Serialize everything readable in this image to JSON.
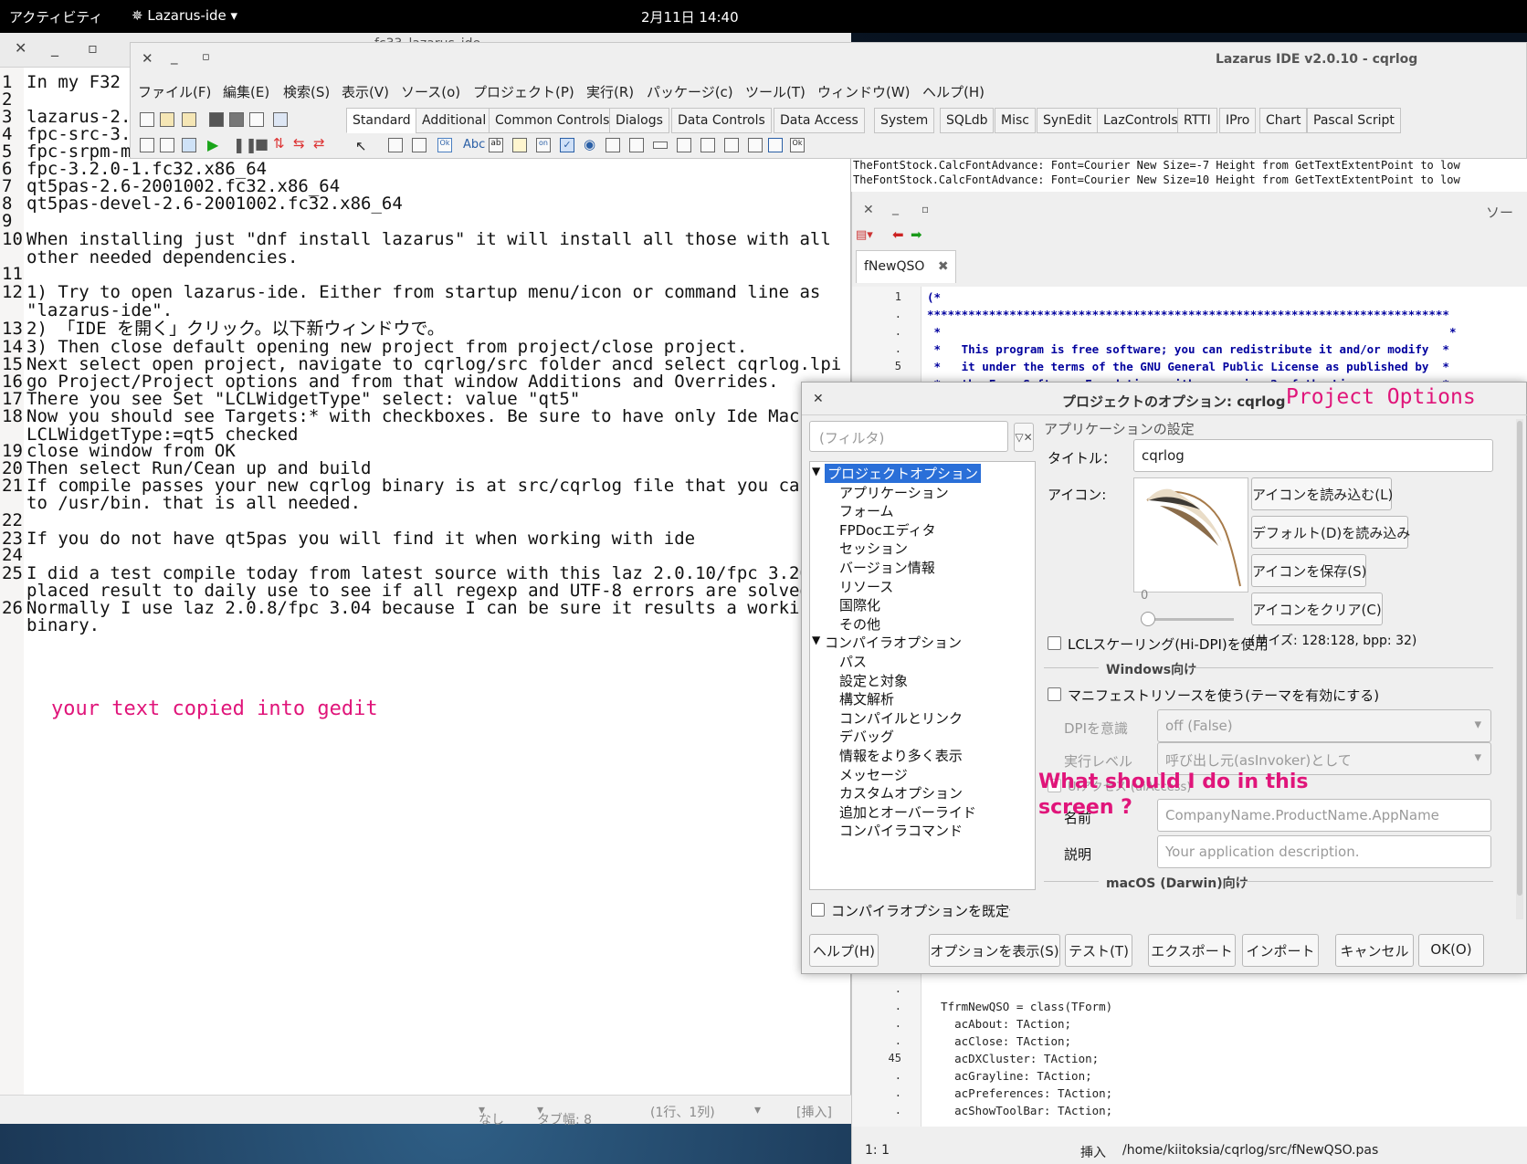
{
  "topbar": {
    "activities": "アクティビティ",
    "app_menu": "Lazarus-ide",
    "clock": "2月11日 14:40"
  },
  "gedit": {
    "lines": [
      {
        "n": "1",
        "t": "In my F32 s"
      },
      {
        "n": "2",
        "t": ""
      },
      {
        "n": "3",
        "t": "lazarus-2.0"
      },
      {
        "n": "4",
        "t": "fpc-src-3.2"
      },
      {
        "n": "5",
        "t": "fpc-srpm-ma"
      },
      {
        "n": "6",
        "t": "fpc-3.2.0-1.fc32.x86_64"
      },
      {
        "n": "7",
        "t": "qt5pas-2.6-2001002.fc32.x86_64"
      },
      {
        "n": "8",
        "t": "qt5pas-devel-2.6-2001002.fc32.x86_64"
      },
      {
        "n": "9",
        "t": ""
      },
      {
        "n": "10",
        "t": "When installing just \"dnf install lazarus\" it will install all those with all"
      },
      {
        "n": "",
        "t": "other needed dependencies."
      },
      {
        "n": "11",
        "t": ""
      },
      {
        "n": "12",
        "t": "1) Try to open lazarus-ide. Either from startup menu/icon or command line as"
      },
      {
        "n": "",
        "t": "\"lazarus-ide\"."
      },
      {
        "n": "13",
        "t": "2) 「IDE を開く」クリック。以下新ウィンドウで。"
      },
      {
        "n": "14",
        "t": "3) Then close default opening new project from project/close project."
      },
      {
        "n": "15",
        "t": "Next select open project, navigate to cqrlog/src folder ancd select cqrlog.lpi"
      },
      {
        "n": "16",
        "t": "go Project/Project options and from that window Additions and Overrides."
      },
      {
        "n": "17",
        "t": "There you see Set \"LCLWidgetType\" select: value \"qt5\""
      },
      {
        "n": "18",
        "t": "Now you should see Targets:* with checkboxes. Be sure to have only Ide Macro"
      },
      {
        "n": "",
        "t": "LCLWidgetType:=qt5 checked"
      },
      {
        "n": "19",
        "t": "close window from OK"
      },
      {
        "n": "20",
        "t": "Then select Run/Cean up and build"
      },
      {
        "n": "21",
        "t": "If compile passes your new cqrlog binary is at src/cqrlog file that you can co"
      },
      {
        "n": "",
        "t": "to /usr/bin. that is all needed."
      },
      {
        "n": "22",
        "t": ""
      },
      {
        "n": "23",
        "t": "If you do not have qt5pas you will find it when working with ide"
      },
      {
        "n": "24",
        "t": ""
      },
      {
        "n": "25",
        "t": "I did a test compile today from latest source with this laz 2.0.10/fpc 3.20 an"
      },
      {
        "n": "",
        "t": "placed result to daily use to see if all regexp and UTF-8 errors are solved no"
      },
      {
        "n": "26",
        "t": "Normally I use laz 2.0.8/fpc 3.04 because I can be sure it results a working"
      },
      {
        "n": "",
        "t": "binary."
      }
    ],
    "annotation": "your text copied into gedit",
    "status": {
      "lang": "なし",
      "tab": "タブ幅: 8",
      "pos": "(1行、1列)",
      "mode": "[挿入]"
    }
  },
  "gedit_tab_title": "fc33_lazarus_ide",
  "lazarus": {
    "title": "Lazarus IDE v2.0.10 - cqrlog",
    "menu": [
      "ファイル(F)",
      "編集(E)",
      "検索(S)",
      "表示(V)",
      "ソース(o)",
      "プロジェクト(P)",
      "実行(R)",
      "パッケージ(c)",
      "ツール(T)",
      "ウィンドウ(W)",
      "ヘルプ(H)"
    ],
    "palette_tabs": [
      "Standard",
      "Additional",
      "Common Controls",
      "Dialogs",
      "Data Controls",
      "Data Access",
      "System",
      "SQLdb",
      "Misc",
      "SynEdit",
      "LazControls",
      "RTTI",
      "IPro",
      "Chart",
      "Pascal Script"
    ]
  },
  "messages": [
    "TheFontStock.CalcFontAdvance: Font=Courier New Size=-7 Height from GetTextExtentPoint to low",
    "TheFontStock.CalcFontAdvance: Font=Courier New Size=10 Height from GetTextExtentPoint to low"
  ],
  "source_editor": {
    "title_partial": "ソー",
    "tab": "fNewQSO",
    "top_lines": [
      {
        "n": "1",
        "t": "(*"
      },
      {
        "n": ".",
        "t": "****************************************************************************"
      },
      {
        "n": ".",
        "t": " *                                                                          *"
      },
      {
        "n": ".",
        "t": " *   This program is free software; you can redistribute it and/or modify  *"
      },
      {
        "n": "5",
        "t": " *   it under the terms of the GNU General Public License as published by  *"
      },
      {
        "n": ".",
        "t": " *   the Free Software Foundation; either version 2 of the License.        *"
      }
    ],
    "bottom_lines": [
      {
        "n": ".",
        "t": ""
      },
      {
        "n": ".",
        "t": "  TfrmNewQSO = class(TForm)"
      },
      {
        "n": ".",
        "t": "    acAbout: TAction;"
      },
      {
        "n": ".",
        "t": "    acClose: TAction;"
      },
      {
        "n": "45",
        "t": "    acDXCluster: TAction;"
      },
      {
        "n": ".",
        "t": "    acGrayline: TAction;"
      },
      {
        "n": ".",
        "t": "    acPreferences: TAction;"
      },
      {
        "n": ".",
        "t": "    acShowToolBar: TAction;"
      }
    ],
    "status": {
      "pos": "1: 1",
      "mode": "挿入",
      "file": "/home/kiitoksia/cqrlog/src/fNewQSO.pas"
    }
  },
  "dialog": {
    "title": "プロジェクトのオプション: cqrlog",
    "annotation_title": "Project Options",
    "filter_placeholder": "(フィルタ)",
    "tree": [
      {
        "label": "プロジェクトオプション",
        "level": 0,
        "selected": true,
        "expander": true
      },
      {
        "label": "アプリケーション",
        "level": 1
      },
      {
        "label": "フォーム",
        "level": 1
      },
      {
        "label": "FPDocエディタ",
        "level": 1
      },
      {
        "label": "セッション",
        "level": 1
      },
      {
        "label": "バージョン情報",
        "level": 1
      },
      {
        "label": "リソース",
        "level": 1
      },
      {
        "label": "国際化",
        "level": 1
      },
      {
        "label": "その他",
        "level": 1
      },
      {
        "label": "コンパイラオプション",
        "level": 0,
        "expander": true
      },
      {
        "label": "パス",
        "level": 1
      },
      {
        "label": "設定と対象",
        "level": 1
      },
      {
        "label": "構文解析",
        "level": 1
      },
      {
        "label": "コンパイルとリンク",
        "level": 1
      },
      {
        "label": "デバッグ",
        "level": 1
      },
      {
        "label": "情報をより多く表示",
        "level": 1
      },
      {
        "label": "メッセージ",
        "level": 1
      },
      {
        "label": "カスタムオプション",
        "level": 1
      },
      {
        "label": "追加とオーバーライド",
        "level": 1
      },
      {
        "label": "コンパイラコマンド",
        "level": 1
      }
    ],
    "default_compiler_opts": "コンパイラオプションを既定値に",
    "group_title": "アプリケーションの設定",
    "title_label": "タイトル：",
    "title_value": "cqrlog",
    "icon_label": "アイコン:",
    "icon_buttons": [
      "アイコンを読み込む(L)",
      "デフォルト(D)を読み込み",
      "アイコンを保存(S)",
      "アイコンをクリア(C)"
    ],
    "slider_value": "0",
    "icon_size": "(サイズ: 128:128, bpp: 32)",
    "lcl_scaling": "LCLスケーリング(Hi-DPI)を使用",
    "windows_section": "Windows向け",
    "manifest": "マニフェストリソースを使う(テーマを有効にする)",
    "dpi_label": "DPIを意識",
    "dpi_value": "off (False)",
    "exec_label": "実行レベル",
    "exec_value": "呼び出し元(asInvoker)として",
    "ui_access": "UIアクセス (uiAccess)",
    "name_label": "名前",
    "name_placeholder": "CompanyName.ProductName.AppName",
    "desc_label": "説明",
    "desc_placeholder": "Your application description.",
    "macos_section": "macOS (Darwin)向け",
    "annotation_question": "What should I do in this screen ?",
    "buttons": [
      "ヘルプ(H)",
      "オプションを表示(S)",
      "テスト(T)",
      "エクスポート",
      "インポート",
      "キャンセル",
      "OK(O)"
    ]
  },
  "colors": {
    "annotation": "#e0157a",
    "selection": "#2a6fd8",
    "keyword": "#00009e"
  }
}
